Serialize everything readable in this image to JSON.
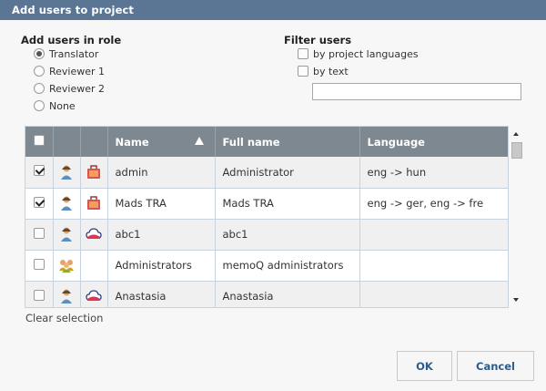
{
  "window": {
    "title": "Add users to project"
  },
  "role_section": {
    "title": "Add users in role",
    "options": [
      {
        "label": "Translator",
        "checked": true
      },
      {
        "label": "Reviewer 1",
        "checked": false
      },
      {
        "label": "Reviewer 2",
        "checked": false
      },
      {
        "label": "None",
        "checked": false
      }
    ]
  },
  "filter_section": {
    "title": "Filter users",
    "by_project_languages": {
      "label": "by project languages",
      "checked": false
    },
    "by_text": {
      "label": "by text",
      "checked": false
    },
    "text_value": ""
  },
  "table": {
    "columns": [
      "Name",
      "Full name",
      "Language"
    ],
    "sorted_column": "Name",
    "rows": [
      {
        "checked": true,
        "user_icon": "user-icon",
        "type_icon": "toolbox-icon",
        "name": "admin",
        "full_name": "Administrator",
        "language": "eng  -> hun"
      },
      {
        "checked": true,
        "user_icon": "user-icon",
        "type_icon": "toolbox-icon",
        "name": "Mads TRA",
        "full_name": "Mads TRA",
        "language": "eng  -> ger, eng  -> fre"
      },
      {
        "checked": false,
        "user_icon": "user-icon",
        "type_icon": "cloud-icon",
        "name": "abc1",
        "full_name": "abc1",
        "language": ""
      },
      {
        "checked": false,
        "user_icon": "group-icon",
        "type_icon": "",
        "name": "Administrators",
        "full_name": "memoQ administrators",
        "language": ""
      },
      {
        "checked": false,
        "user_icon": "user-icon",
        "type_icon": "cloud-icon",
        "name": "Anastasia",
        "full_name": "Anastasia",
        "language": ""
      }
    ]
  },
  "clear_selection_label": "Clear selection",
  "buttons": {
    "ok": "OK",
    "cancel": "Cancel"
  },
  "colors": {
    "title_bar": "#5a7694",
    "header": "#7d8890",
    "button_text": "#2b5c8a"
  }
}
